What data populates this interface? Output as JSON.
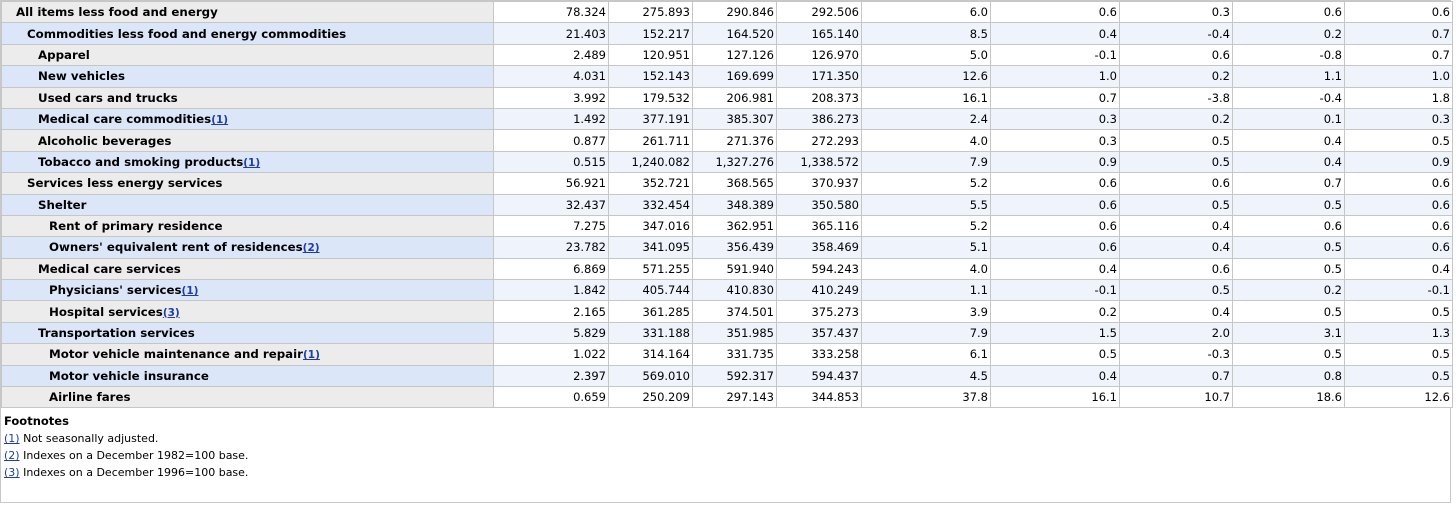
{
  "table": {
    "rows": [
      {
        "label": "All items less food and energy",
        "fn": "",
        "level": 0,
        "values": [
          "78.324",
          "275.893",
          "290.846",
          "292.506",
          "6.0",
          "0.6",
          "0.3",
          "0.6",
          "0.6"
        ]
      },
      {
        "label": "Commodities less food and energy commodities",
        "fn": "",
        "level": 1,
        "values": [
          "21.403",
          "152.217",
          "164.520",
          "165.140",
          "8.5",
          "0.4",
          "-0.4",
          "0.2",
          "0.7"
        ]
      },
      {
        "label": "Apparel",
        "fn": "",
        "level": 2,
        "values": [
          "2.489",
          "120.951",
          "127.126",
          "126.970",
          "5.0",
          "-0.1",
          "0.6",
          "-0.8",
          "0.7"
        ]
      },
      {
        "label": "New vehicles",
        "fn": "",
        "level": 2,
        "values": [
          "4.031",
          "152.143",
          "169.699",
          "171.350",
          "12.6",
          "1.0",
          "0.2",
          "1.1",
          "1.0"
        ]
      },
      {
        "label": "Used cars and trucks",
        "fn": "",
        "level": 2,
        "values": [
          "3.992",
          "179.532",
          "206.981",
          "208.373",
          "16.1",
          "0.7",
          "-3.8",
          "-0.4",
          "1.8"
        ]
      },
      {
        "label": "Medical care commodities",
        "fn": "(1)",
        "level": 2,
        "values": [
          "1.492",
          "377.191",
          "385.307",
          "386.273",
          "2.4",
          "0.3",
          "0.2",
          "0.1",
          "0.3"
        ]
      },
      {
        "label": "Alcoholic beverages",
        "fn": "",
        "level": 2,
        "values": [
          "0.877",
          "261.711",
          "271.376",
          "272.293",
          "4.0",
          "0.3",
          "0.5",
          "0.4",
          "0.5"
        ]
      },
      {
        "label": "Tobacco and smoking products",
        "fn": "(1)",
        "level": 2,
        "values": [
          "0.515",
          "1,240.082",
          "1,327.276",
          "1,338.572",
          "7.9",
          "0.9",
          "0.5",
          "0.4",
          "0.9"
        ]
      },
      {
        "label": "Services less energy services",
        "fn": "",
        "level": 1,
        "values": [
          "56.921",
          "352.721",
          "368.565",
          "370.937",
          "5.2",
          "0.6",
          "0.6",
          "0.7",
          "0.6"
        ]
      },
      {
        "label": "Shelter",
        "fn": "",
        "level": 2,
        "values": [
          "32.437",
          "332.454",
          "348.389",
          "350.580",
          "5.5",
          "0.6",
          "0.5",
          "0.5",
          "0.6"
        ]
      },
      {
        "label": "Rent of primary residence",
        "fn": "",
        "level": 3,
        "values": [
          "7.275",
          "347.016",
          "362.951",
          "365.116",
          "5.2",
          "0.6",
          "0.4",
          "0.6",
          "0.6"
        ]
      },
      {
        "label": "Owners' equivalent rent of residences",
        "fn": "(2)",
        "level": 3,
        "values": [
          "23.782",
          "341.095",
          "356.439",
          "358.469",
          "5.1",
          "0.6",
          "0.4",
          "0.5",
          "0.6"
        ]
      },
      {
        "label": "Medical care services",
        "fn": "",
        "level": 2,
        "values": [
          "6.869",
          "571.255",
          "591.940",
          "594.243",
          "4.0",
          "0.4",
          "0.6",
          "0.5",
          "0.4"
        ]
      },
      {
        "label": "Physicians' services",
        "fn": "(1)",
        "level": 3,
        "values": [
          "1.842",
          "405.744",
          "410.830",
          "410.249",
          "1.1",
          "-0.1",
          "0.5",
          "0.2",
          "-0.1"
        ]
      },
      {
        "label": "Hospital services",
        "fn": "(3)",
        "level": 3,
        "values": [
          "2.165",
          "361.285",
          "374.501",
          "375.273",
          "3.9",
          "0.2",
          "0.4",
          "0.5",
          "0.5"
        ]
      },
      {
        "label": "Transportation services",
        "fn": "",
        "level": 2,
        "values": [
          "5.829",
          "331.188",
          "351.985",
          "357.437",
          "7.9",
          "1.5",
          "2.0",
          "3.1",
          "1.3"
        ]
      },
      {
        "label": "Motor vehicle maintenance and repair",
        "fn": "(1)",
        "level": 3,
        "values": [
          "1.022",
          "314.164",
          "331.735",
          "333.258",
          "6.1",
          "0.5",
          "-0.3",
          "0.5",
          "0.5"
        ]
      },
      {
        "label": "Motor vehicle insurance",
        "fn": "",
        "level": 3,
        "values": [
          "2.397",
          "569.010",
          "592.317",
          "594.437",
          "4.5",
          "0.4",
          "0.7",
          "0.8",
          "0.5"
        ]
      },
      {
        "label": "Airline fares",
        "fn": "",
        "level": 3,
        "values": [
          "0.659",
          "250.209",
          "297.143",
          "344.853",
          "37.8",
          "16.1",
          "10.7",
          "18.6",
          "12.6"
        ]
      }
    ]
  },
  "footnotes": {
    "title": "Footnotes",
    "items": [
      {
        "ref": "(1)",
        "text": " Not seasonally adjusted."
      },
      {
        "ref": "(2)",
        "text": " Indexes on a December 1982=100 base."
      },
      {
        "ref": "(3)",
        "text": " Indexes on a December 1996=100 base."
      }
    ]
  },
  "colors": {
    "label_bg": "#ececec",
    "label_bg_alt": "#dbe6f9",
    "value_bg_alt": "#eef3fc",
    "link": "#1d3ea8",
    "border": "#c6c6c6"
  }
}
